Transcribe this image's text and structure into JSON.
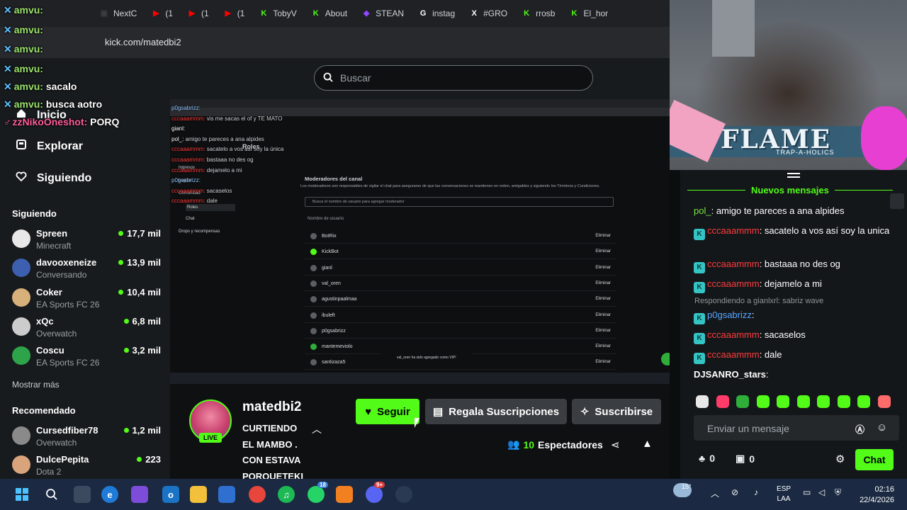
{
  "browser": {
    "tabs": [
      {
        "label": "NextC",
        "icon": "video-icon",
        "color": "#3a3d42"
      },
      {
        "label": "(1",
        "icon": "youtube-icon",
        "color": "#ff0000"
      },
      {
        "label": "(1",
        "icon": "youtube-icon",
        "color": "#ff0000"
      },
      {
        "label": "(1",
        "icon": "youtube-icon",
        "color": "#ff0000"
      },
      {
        "label": "TobyV",
        "icon": "kick-icon",
        "color": "#53fc18"
      },
      {
        "label": "About",
        "icon": "kick-icon",
        "color": "#53fc18"
      },
      {
        "label": "STEAN",
        "icon": "twitch-icon",
        "color": "#9146ff"
      },
      {
        "label": "instag",
        "icon": "google-icon",
        "color": "#ffffff"
      },
      {
        "label": "#GRO",
        "icon": "x-icon",
        "color": "#ffffff"
      },
      {
        "label": "rrosb",
        "icon": "kick-icon",
        "color": "#53fc18"
      },
      {
        "label": "El_hor",
        "icon": "kick-icon",
        "color": "#53fc18"
      }
    ],
    "url": "kick.com/matedbi2"
  },
  "header": {
    "search_placeholder": "Buscar"
  },
  "sidebar": {
    "nav": [
      {
        "label": "Inicio",
        "icon": "home-icon"
      },
      {
        "label": "Explorar",
        "icon": "compass-icon"
      },
      {
        "label": "Siguiendo",
        "icon": "heart-icon"
      }
    ],
    "following_title": "Siguiendo",
    "following": [
      {
        "name": "Spreen",
        "game": "Minecraft",
        "viewers": "17,7 mil"
      },
      {
        "name": "davooxeneize",
        "game": "Conversando",
        "viewers": "13,9 mil"
      },
      {
        "name": "Coker",
        "game": "EA Sports FC 26",
        "viewers": "10,4 mil"
      },
      {
        "name": "xQc",
        "game": "Overwatch",
        "viewers": "6,8 mil"
      },
      {
        "name": "Coscu",
        "game": "EA Sports FC 26",
        "viewers": "3,2 mil"
      }
    ],
    "show_more": "Mostrar más",
    "recommended_title": "Recomendado",
    "recommended": [
      {
        "name": "Cursedfiber78",
        "game": "Overwatch",
        "viewers": "1,2 mil"
      },
      {
        "name": "DulcePepita",
        "game": "Dota 2",
        "viewers": "223"
      }
    ]
  },
  "overlay_chat": [
    {
      "user": "amvu",
      "text": ""
    },
    {
      "user": "amvu",
      "text": ""
    },
    {
      "user": "amvu",
      "text": ""
    },
    {
      "user": "amvu",
      "text": ""
    },
    {
      "user": "amvu",
      "text": "sacalo"
    },
    {
      "user": "amvu",
      "text": "busca aotro"
    },
    {
      "user": "zzNikoOneshot",
      "text": "PORQ"
    }
  ],
  "stream": {
    "inner_chat": [
      {
        "user": "p0gsabrizz",
        "text": ""
      },
      {
        "user": "cccaaammm",
        "text": "vis me sacas el of y TE MATO"
      },
      {
        "user": "gianl",
        "text": ""
      },
      {
        "user": "pol_",
        "text": "amigo te pareces a ana alpides"
      },
      {
        "user": "cccaaammm",
        "text": "sacatelo a vos así soy la única"
      },
      {
        "user": "cccaaammm",
        "text": "bastaaa no des og"
      },
      {
        "user": "cccaaammm",
        "text": "dejamelo a mi"
      },
      {
        "user": "p0gsabrizz",
        "text": ""
      },
      {
        "user": "cccaaammm",
        "text": "sacaselos"
      },
      {
        "user": "cccaaammm",
        "text": "dale"
      }
    ],
    "dashboard": {
      "side_title": "Roles",
      "side_items": [
        "Ingresos",
        "Logros",
        "Comunidad",
        "Roles",
        "Chat",
        "Drops y recompensas"
      ],
      "section_title": "Moderadores del canal",
      "section_desc": "Los moderadores son responsables de vigilar el chat para asegurarse de que las conversaciones se mantienen en orden, amigables y siguiendo los Términos y Condiciones.",
      "search_placeholder": "Busca el nombre de usuario para agregar moderador",
      "col_header": "Nombre de usuario",
      "action_label": "Eliminar",
      "moderators": [
        "BotRix",
        "KickBot",
        "gianl",
        "val_oren",
        "agustinpaalmaa",
        "ibuleft",
        "p0gsabrizz",
        "mantemeviolo",
        "santizaza5"
      ],
      "toast": "val_oren ha sido agregado como VIP!"
    }
  },
  "cam": {
    "banner": "FLAME",
    "banner_sub": "TRAP-A-HOLICS"
  },
  "chat": {
    "new_messages": "Nuevos mensajes",
    "messages": [
      {
        "user": "pol_",
        "text": "amigo te pareces a ana alpides",
        "color": "#74e83d",
        "badge": false
      },
      {
        "user": "cccaaammm",
        "text": "sacatelo a vos así soy la unica",
        "color": "#ff3b3b",
        "badge": true
      },
      {
        "user": "cccaaammm",
        "text": "bastaaa no des og",
        "color": "#ff3b3b",
        "badge": true
      },
      {
        "user": "cccaaammm",
        "text": "dejamelo a mi",
        "color": "#ff3b3b",
        "badge": true
      },
      {
        "user": "p0gsabrizz",
        "text": "",
        "color": "#5aa6ff",
        "badge": true
      },
      {
        "user": "cccaaammm",
        "text": "sacaselos",
        "color": "#ff3b3b",
        "badge": true
      },
      {
        "user": "cccaaammm",
        "text": "dale",
        "color": "#ff3b3b",
        "badge": true
      },
      {
        "user": "DJSANRO_stars",
        "text": "",
        "color": "#ffffff",
        "badge": false
      }
    ],
    "reply_text": "Respondiendo a gianlxrl: sabriz wave",
    "input_placeholder": "Enviar un mensaje",
    "count_a": "0",
    "count_b": "0",
    "send_label": "Chat"
  },
  "channel": {
    "name": "matedbi2",
    "live_badge": "LIVE",
    "title": "CURTIENDO EL MAMBO . CON ESTAVA PORQUETEKI",
    "title_lines": [
      "CURTIENDO",
      "EL MAMBO .",
      "CON ESTAVA",
      "PORQUETEKI"
    ],
    "follow_label": "Seguir",
    "gift_label": "Regala Suscripciones",
    "subscribe_label": "Suscribirse",
    "viewers_count": "10",
    "viewers_label": "Espectadores"
  },
  "taskbar": {
    "weather": "15°",
    "lang_top": "ESP",
    "lang_bottom": "LAA",
    "time": "02:16",
    "date": "22/4/2026",
    "whatsapp_badge": "18",
    "discord_badge": "9+"
  },
  "colors": {
    "kick_green": "#53fc18",
    "bg_dark": "#0b0e0f",
    "panel": "#181b1d"
  }
}
